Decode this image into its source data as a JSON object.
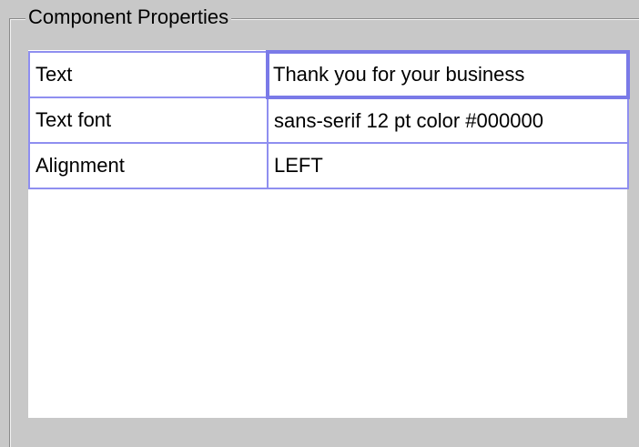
{
  "group": {
    "title": "Component Properties"
  },
  "properties": [
    {
      "name": "Text",
      "value": "Thank you for your business"
    },
    {
      "name": "Text font",
      "value": "sans-serif 12 pt color #000000"
    },
    {
      "name": "Alignment",
      "value": "LEFT"
    }
  ],
  "colors": {
    "panel_background": "#c8c8c8",
    "grid_lines": "#8f8ff0",
    "table_background": "#ffffff"
  }
}
